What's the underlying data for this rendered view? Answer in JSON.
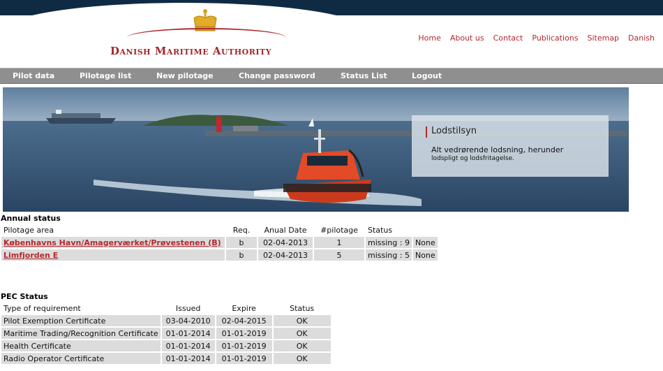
{
  "header": {
    "logo_text": "Danish Maritime Authority",
    "top_links": [
      "Home",
      "About us",
      "Contact",
      "Publications",
      "Sitemap",
      "Danish"
    ]
  },
  "nav": {
    "items": [
      "Pilot data",
      "Pilotage list",
      "New pilotage",
      "Change password",
      "Status List",
      "Logout"
    ]
  },
  "hero": {
    "title": "Lodstilsyn",
    "text_line1": "Alt vedrørende lodsning, herunder",
    "text_line2": "lodspligt og lodsfritagelse."
  },
  "annual_status": {
    "title": "Annual status",
    "headers": [
      "Pilotage area",
      "Req.",
      "Anual Date",
      "#pilotage",
      "Status"
    ],
    "rows": [
      {
        "area": "Københavns Havn/Amagerværket/Prøvestenen (B)",
        "req": "b",
        "date": "02-04-2013",
        "count": "1",
        "status": "missing : 9",
        "extra": "None"
      },
      {
        "area": "Limfjorden E",
        "req": "b",
        "date": "02-04-2013",
        "count": "5",
        "status": "missing : 5",
        "extra": "None"
      }
    ]
  },
  "pec_status": {
    "title": "PEC Status",
    "headers": [
      "Type of requirement",
      "Issued",
      "Expire",
      "Status"
    ],
    "rows": [
      {
        "type": "Pilot Exemption Certificate",
        "issued": "03-04-2010",
        "expire": "02-04-2015",
        "status": "OK"
      },
      {
        "type": "Maritime Trading/Recognition Certificate",
        "issued": "01-01-2014",
        "expire": "01-01-2019",
        "status": "OK"
      },
      {
        "type": "Health Certificate",
        "issued": "01-01-2014",
        "expire": "01-01-2019",
        "status": "OK"
      },
      {
        "type": "Radio Operator Certificate",
        "issued": "01-01-2014",
        "expire": "01-01-2019",
        "status": "OK"
      }
    ]
  },
  "colors": {
    "brand_red": "#b3282d",
    "top_bar": "#0f2a43",
    "nav_gray": "#8f8f8f",
    "cell_gray": "#dcdcdc"
  }
}
